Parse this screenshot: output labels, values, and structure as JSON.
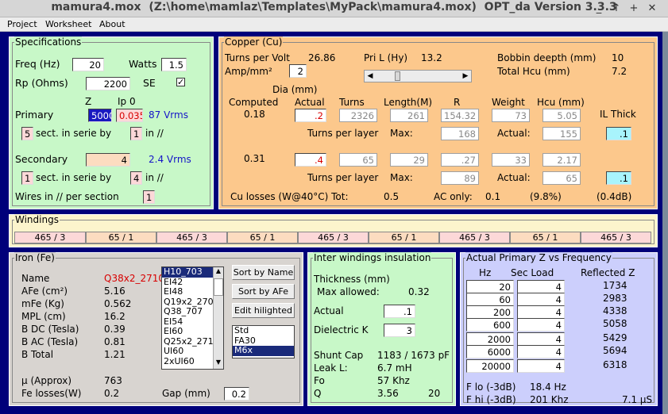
{
  "window": {
    "title": "mamura4.mox  (Z:\\home\\mamlaz\\Templates\\MyPack\\mamura4.mox)  OPT_da Version 3.3.3"
  },
  "menu": [
    "Project",
    "Worksheet",
    "About"
  ],
  "spec": {
    "title": "Specifications",
    "freq_label": "Freq (Hz)",
    "freq": "20",
    "watts_label": "Watts",
    "watts": "1.5",
    "rp_label": "Rp (Ohms)",
    "rp": "2200",
    "se_label": "SE",
    "se_check": "✓",
    "z_label": "Z",
    "ip0_label": "Ip 0",
    "primary_label": "Primary",
    "primary_z": "5000",
    "primary_ip0": "0.035",
    "primary_vrms": "87 Vrms",
    "p_sect": "5",
    "p_sect_label": "sect. in serie by",
    "p_par": "1",
    "p_par_label": "in //",
    "secondary_label": "Secondary",
    "secondary_z": "4",
    "secondary_vrms": "2.4 Vrms",
    "s_sect": "1",
    "s_sect_label": "sect. in serie by",
    "s_par": "4",
    "s_par_label": "in //",
    "wires_label": "Wires in // per section",
    "wires": "1"
  },
  "copper": {
    "title": "Copper (Cu)",
    "tpv_label": "Turns per Volt",
    "tpv": "26.86",
    "pril_label": "Pri L (Hy)",
    "pril": "13.2",
    "bobbin_label": "Bobbin deepth (mm)",
    "bobbin": "10",
    "amp_label": "Amp/mm²",
    "amp": "2",
    "total_hcu_label": "Total Hcu (mm)",
    "total_hcu": "7.2",
    "dia_label": "Dia (mm)",
    "computed_label": "Computed",
    "actual_label": "Actual",
    "turns_label": "Turns",
    "length_label": "Length(M)",
    "r_label": "R",
    "weight_label": "Weight",
    "hcu_label": "Hcu (mm)",
    "il_label": "IL Thick",
    "r1": {
      "computed": "0.18",
      "actual": ".2",
      "turns": "2326",
      "length": "261",
      "r": "154.32",
      "weight": "73",
      "hcu": "5.05",
      "il": ".1",
      "tpl_label": "Turns per layer",
      "max_label": "Max:",
      "max": "168",
      "act_label": "Actual:",
      "act": "155"
    },
    "r2": {
      "computed": "0.31",
      "actual": ".4",
      "turns": "65",
      "length": "29",
      "r": ".27",
      "weight": "33",
      "hcu": "2.17",
      "il": ".1",
      "tpl_label": "Turns per layer",
      "max_label": "Max:",
      "max": "89",
      "act_label": "Actual:",
      "act": "65"
    },
    "cu_label": "Cu losses (W@40°C) Tot:",
    "cu_tot": "0.5",
    "ac_label": "AC only:",
    "ac": "0.1",
    "pct": "(9.8%)",
    "db": "(0.4dB)"
  },
  "windings": {
    "title": "Windings",
    "cells": [
      "465 / 3",
      "65 / 1",
      "465 / 3",
      "65 / 1",
      "465 / 3",
      "65 / 1",
      "465 / 3",
      "65 / 1",
      "465 / 3"
    ]
  },
  "iron": {
    "title": "Iron (Fe)",
    "name_label": "Name",
    "name": "Q38x2_2710",
    "afe_label": "AFe (cm²)",
    "afe": "5.16",
    "mfe_label": "mFe (Kg)",
    "mfe": "0.562",
    "mpl_label": "MPL (cm)",
    "mpl": "16.2",
    "bdc_label": "B DC (Tesla)",
    "bdc": "0.39",
    "bac_label": "B AC (Tesla)",
    "bac": "0.81",
    "btot_label": "B Total",
    "btot": "1.21",
    "mu_label": "µ (Approx)",
    "mu": "763",
    "fe_label": "Fe losses(W)",
    "fe": "0.2",
    "gap_label": "Gap (mm)",
    "gap": "0.2",
    "cores": [
      "H10_703",
      "EI42",
      "EI48",
      "Q19x2_2709",
      "Q38_707",
      "EI54",
      "EI60",
      "Q25x2_2713",
      "UI60",
      "2xUI60"
    ],
    "btn_name": "Sort by Name",
    "btn_afe": "Sort by AFe",
    "btn_edit": "Edit hilighted",
    "types": [
      "Std",
      "FA30",
      "M6x"
    ]
  },
  "insul": {
    "title": "Inter windings insulation",
    "thick_label": "Thickness (mm)",
    "max_label": "Max allowed:",
    "max": "0.32",
    "actual_label": "Actual",
    "actual": ".1",
    "diel_label": "Dielectric K",
    "diel": "3",
    "shunt_label": "Shunt Cap",
    "shunt": "1183 / 1673 pF",
    "leak_label": "Leak L:",
    "leak": "6.7 mH",
    "fo_label": "Fo",
    "fo": "57 Khz",
    "q_label": "Q",
    "q": "3.56",
    "q2": "20"
  },
  "freq": {
    "title": "Actual Primary Z vs Frequency",
    "hz_label": "Hz",
    "load_label": "Sec Load",
    "z_label": "Reflected Z",
    "rows": [
      {
        "hz": "20",
        "load": "4",
        "z": "1734"
      },
      {
        "hz": "60",
        "load": "4",
        "z": "2983"
      },
      {
        "hz": "200",
        "load": "4",
        "z": "4338"
      },
      {
        "hz": "600",
        "load": "4",
        "z": "5058"
      },
      {
        "hz": "2000",
        "load": "4",
        "z": "5429"
      },
      {
        "hz": "6000",
        "load": "4",
        "z": "5694"
      },
      {
        "hz": "20000",
        "load": "4",
        "z": "6318"
      }
    ],
    "flo_label": "F lo (-3dB)",
    "flo": "18.4 Hz",
    "fhi_label": "F hi (-3dB)",
    "fhi": "201 Khz",
    "rise": "7.1 µS"
  }
}
